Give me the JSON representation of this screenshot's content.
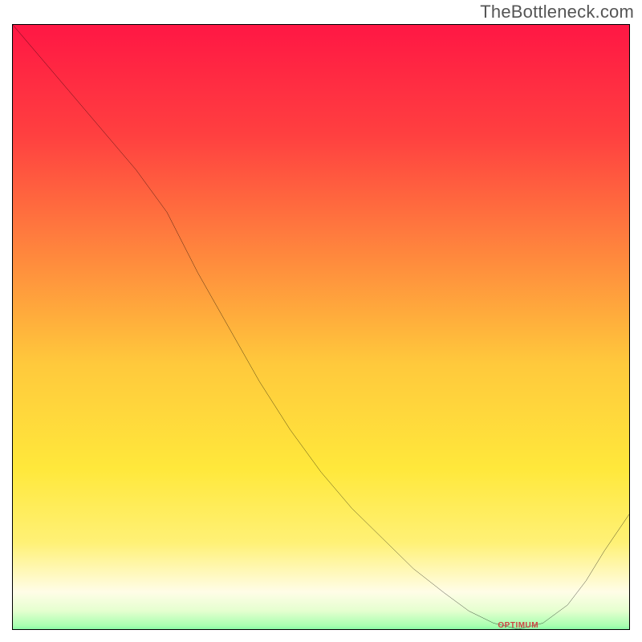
{
  "watermark": "TheBottleneck.com",
  "marker_label": "OPTIMUM",
  "chart_data": {
    "type": "line",
    "title": "",
    "xlabel": "",
    "ylabel": "",
    "xlim": [
      0,
      1
    ],
    "ylim": [
      0,
      1
    ],
    "grid": false,
    "legend_position": "none",
    "annotations": [
      {
        "text": "OPTIMUM",
        "x": 0.82,
        "y": 0.0,
        "color": "#cc4444"
      }
    ],
    "series": [
      {
        "name": "bottleneck-curve",
        "color": "#000000",
        "x": [
          0.0,
          0.05,
          0.1,
          0.15,
          0.2,
          0.25,
          0.3,
          0.35,
          0.4,
          0.45,
          0.5,
          0.55,
          0.6,
          0.65,
          0.7,
          0.74,
          0.78,
          0.82,
          0.86,
          0.9,
          0.93,
          0.96,
          1.0
        ],
        "y": [
          1.0,
          0.94,
          0.88,
          0.82,
          0.76,
          0.69,
          0.59,
          0.5,
          0.41,
          0.33,
          0.26,
          0.2,
          0.15,
          0.1,
          0.06,
          0.03,
          0.01,
          0.0,
          0.01,
          0.04,
          0.08,
          0.13,
          0.19
        ]
      }
    ],
    "gradient": {
      "orientation": "vertical",
      "stops": [
        {
          "pos": 0.0,
          "color": "#ff1744"
        },
        {
          "pos": 0.18,
          "color": "#ff4040"
        },
        {
          "pos": 0.38,
          "color": "#ff8a3d"
        },
        {
          "pos": 0.55,
          "color": "#ffc93c"
        },
        {
          "pos": 0.72,
          "color": "#ffe83b"
        },
        {
          "pos": 0.84,
          "color": "#fff176"
        },
        {
          "pos": 0.92,
          "color": "#fffde7"
        },
        {
          "pos": 0.95,
          "color": "#e6ffd0"
        },
        {
          "pos": 0.975,
          "color": "#a8ffb0"
        },
        {
          "pos": 1.0,
          "color": "#16e27f"
        }
      ]
    }
  }
}
